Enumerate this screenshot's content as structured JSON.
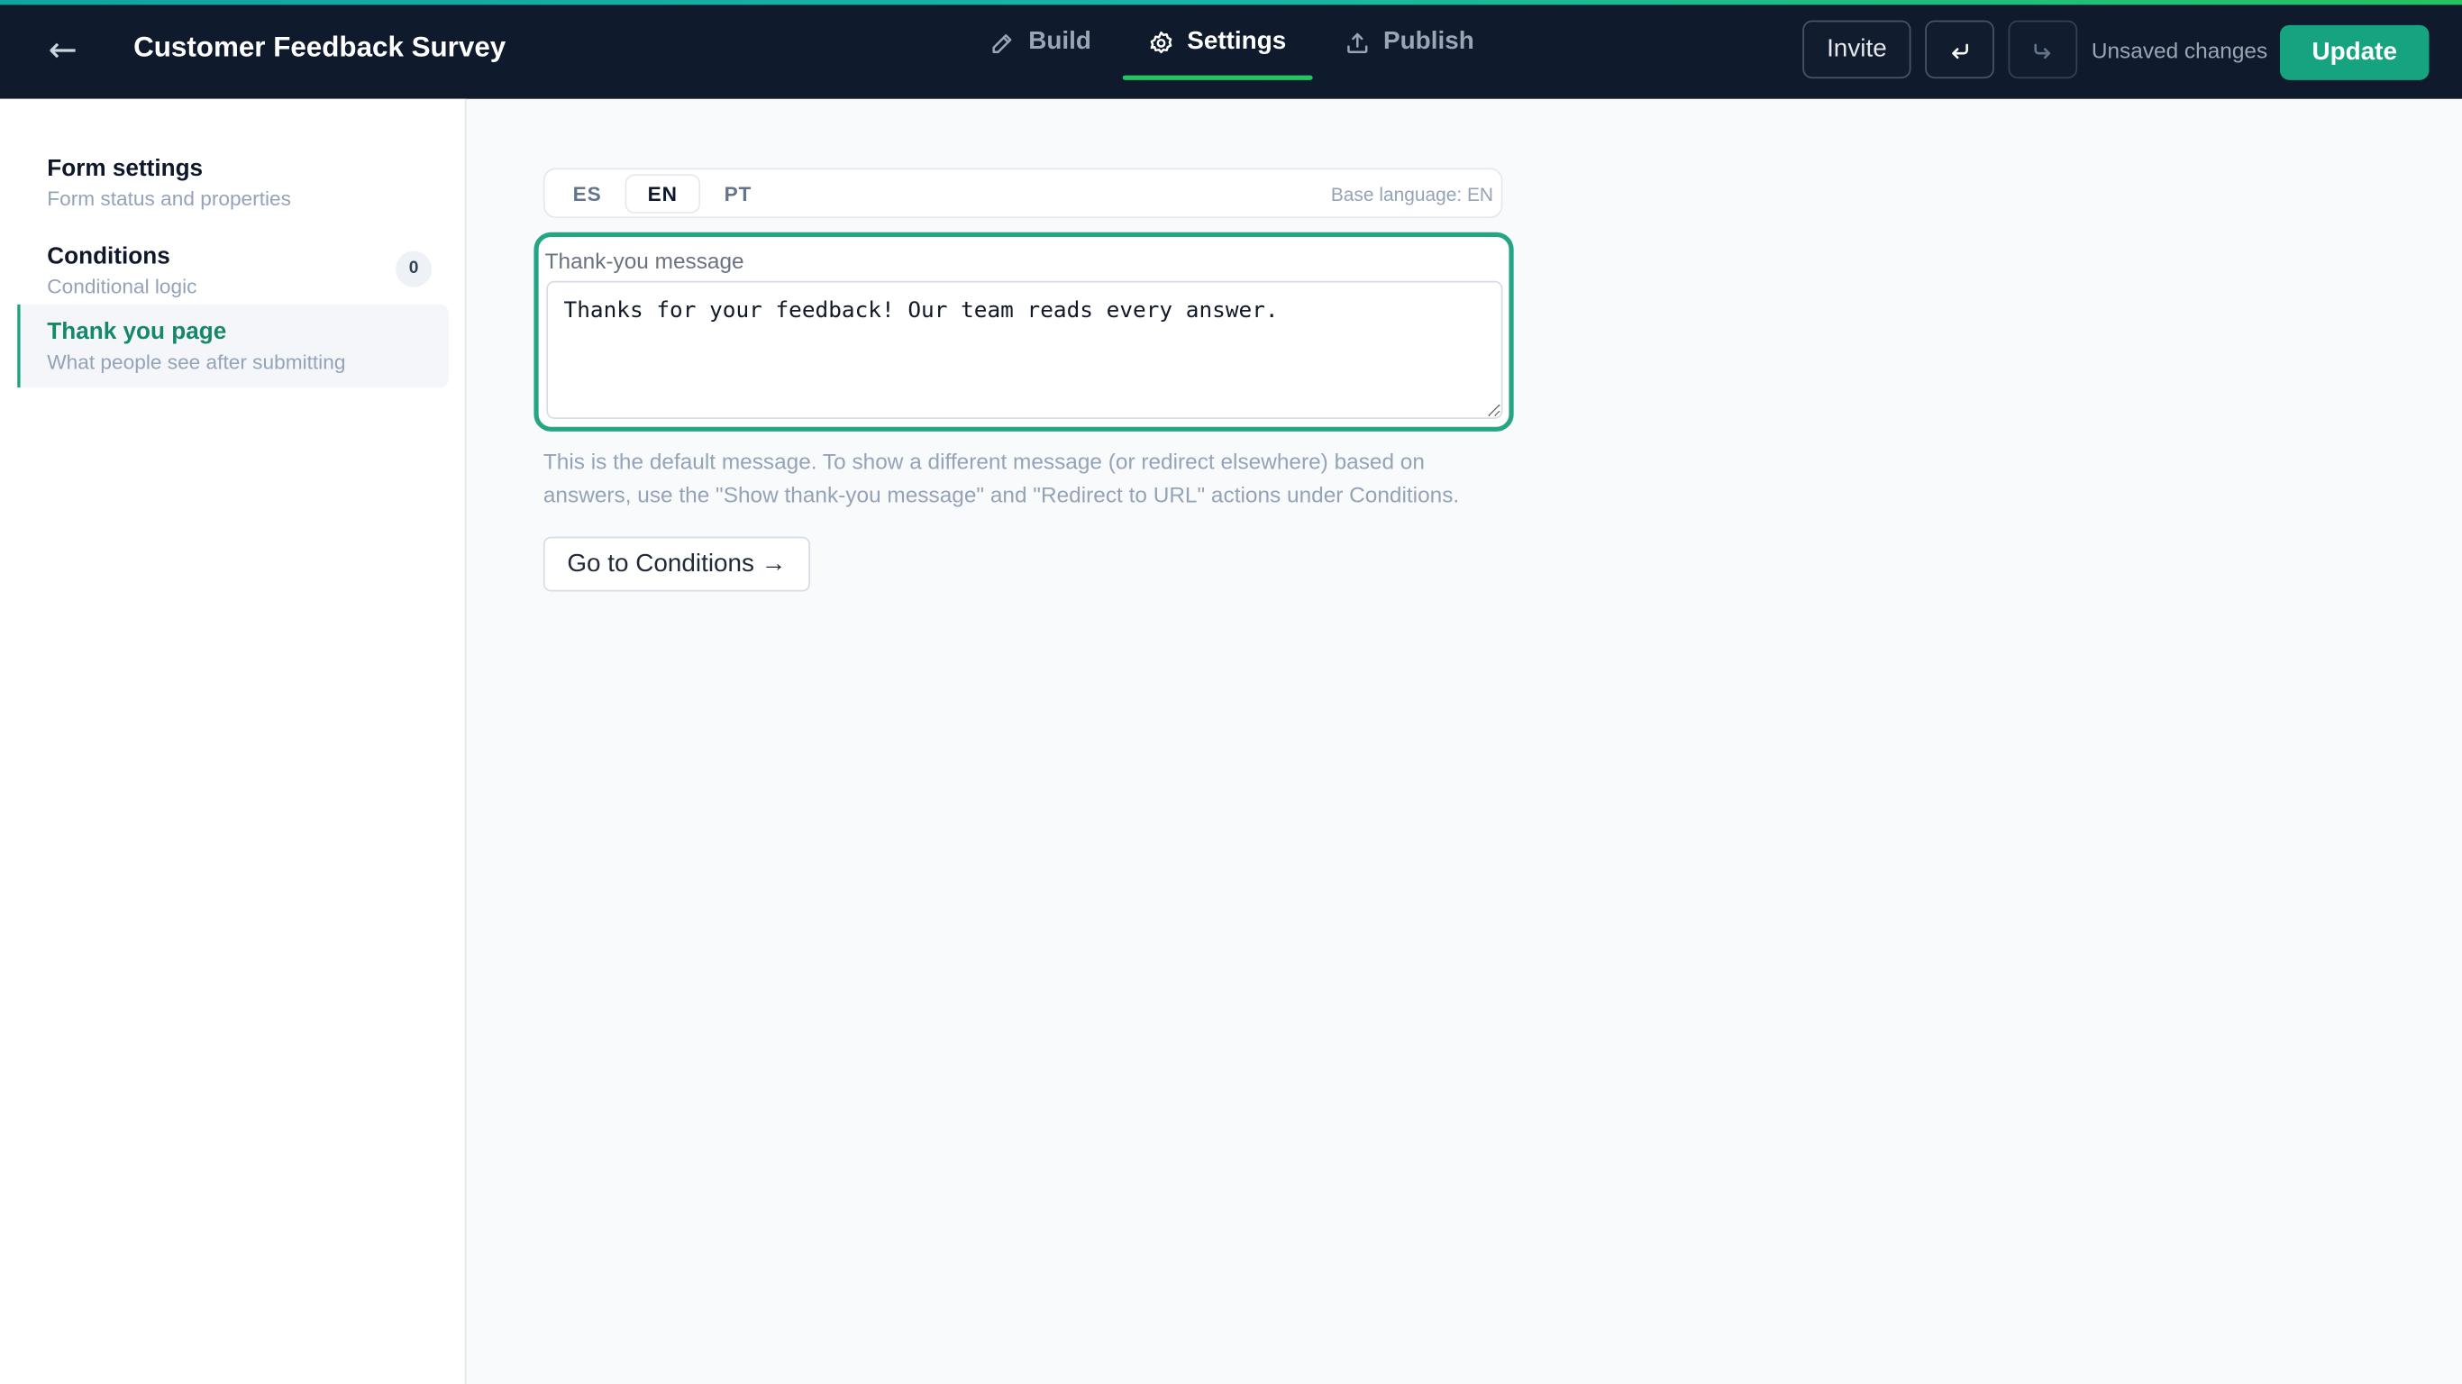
{
  "header": {
    "back_icon": "arrow-left-icon",
    "title": "Customer Feedback Survey",
    "tabs": [
      {
        "label": "Build",
        "icon": "pencil-icon",
        "active": false
      },
      {
        "label": "Settings",
        "icon": "gear-icon",
        "active": true
      },
      {
        "label": "Publish",
        "icon": "upload-icon",
        "active": false
      }
    ],
    "invite_label": "Invite",
    "undo_icon": "undo-icon",
    "redo_icon": "redo-icon",
    "status": "Unsaved changes",
    "update_label": "Update"
  },
  "sidebar": {
    "items": [
      {
        "title": "Form settings",
        "subtitle": "Form status and properties",
        "active": false
      },
      {
        "title": "Conditions",
        "subtitle": "Conditional logic",
        "count": "0",
        "active": false
      },
      {
        "title": "Thank you page",
        "subtitle": "What people see after submitting",
        "active": true
      }
    ]
  },
  "main": {
    "languages": [
      "ES",
      "EN",
      "PT"
    ],
    "active_language": "EN",
    "base_language": "Base language: EN",
    "message_label": "Thank-you message",
    "message_value": "Thanks for your feedback! Our team reads every answer.",
    "help_text": "This is the default message. To show a different message (or redirect elsewhere) based on answers, use the \"Show thank-you message\" and \"Redirect to URL\" actions under Conditions.",
    "goto_button": "Go to Conditions →"
  },
  "colors": {
    "topbar": "#0f1b2d",
    "accent": "#16a37f",
    "active_tab_underline": "#22c55e"
  }
}
